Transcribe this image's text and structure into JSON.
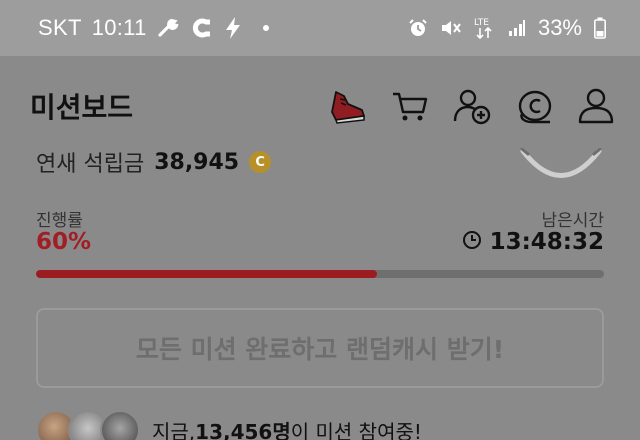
{
  "status_bar": {
    "carrier": "SKT",
    "time": "10:11",
    "battery": "33%",
    "network": "LTE",
    "left_icons": [
      "wrench-icon",
      "magnet-icon",
      "bolt-icon",
      "dot-icon"
    ],
    "right_icons": [
      "alarm-icon",
      "mute-icon",
      "lte-icon",
      "signal-icon",
      "battery-icon"
    ]
  },
  "app_bar": {
    "title": "미션보드",
    "icons": [
      "sneaker-icon",
      "cart-icon",
      "add-user-icon",
      "coin-stack-icon",
      "profile-icon"
    ]
  },
  "accumulation": {
    "label": "연새 석립금",
    "amount": "38,945",
    "coin_symbol": "C"
  },
  "progress": {
    "label": "진행률",
    "value_text": "60%",
    "value": 0.6,
    "bar_color": "#9b1d22"
  },
  "remaining_time": {
    "label": "남은시간",
    "value": "13:48:32"
  },
  "cta": {
    "label": "모든 미션 완료하고 랜덤캐시 받기!"
  },
  "participants": {
    "prefix": "지금, ",
    "count": "13,456명",
    "suffix": "이 미션 참여중!"
  }
}
